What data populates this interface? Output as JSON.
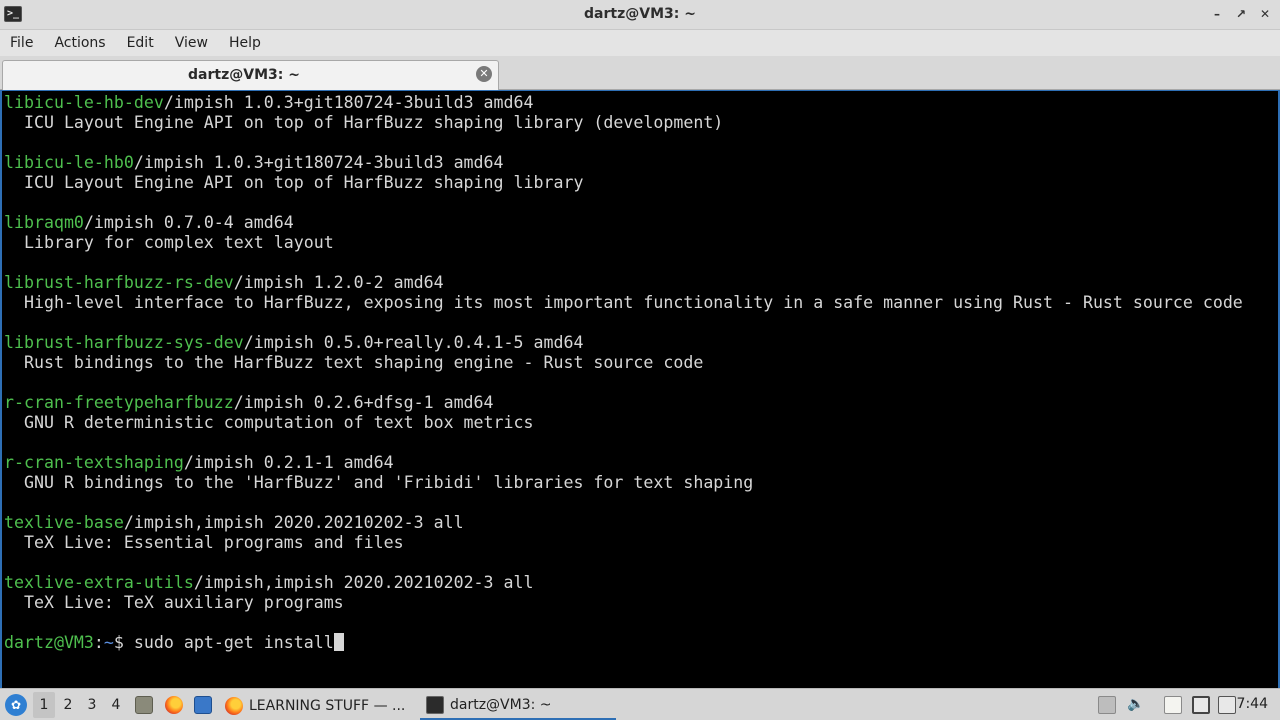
{
  "window": {
    "title": "dartz@VM3: ~",
    "app_icon": "terminal-icon",
    "controls": [
      "minimize-icon",
      "maximize-icon",
      "close-icon"
    ]
  },
  "menubar": {
    "items": [
      "File",
      "Actions",
      "Edit",
      "View",
      "Help"
    ]
  },
  "tabs": [
    {
      "label": "dartz@VM3: ~",
      "close_icon": "close-circle-icon"
    }
  ],
  "terminal": {
    "lines": [
      {
        "pkg": "libicu-le-hb-dev",
        "rest": "/impish 1.0.3+git180724-3build3 amd64"
      },
      {
        "text": "  ICU Layout Engine API on top of HarfBuzz shaping library (development)"
      },
      {
        "text": ""
      },
      {
        "pkg": "libicu-le-hb0",
        "rest": "/impish 1.0.3+git180724-3build3 amd64"
      },
      {
        "text": "  ICU Layout Engine API on top of HarfBuzz shaping library"
      },
      {
        "text": ""
      },
      {
        "pkg": "libraqm0",
        "rest": "/impish 0.7.0-4 amd64"
      },
      {
        "text": "  Library for complex text layout"
      },
      {
        "text": ""
      },
      {
        "pkg": "librust-harfbuzz-rs-dev",
        "rest": "/impish 1.2.0-2 amd64"
      },
      {
        "text": "  High-level interface to HarfBuzz, exposing its most important functionality in a safe manner using Rust - Rust source code"
      },
      {
        "text": ""
      },
      {
        "pkg": "librust-harfbuzz-sys-dev",
        "rest": "/impish 0.5.0+really.0.4.1-5 amd64"
      },
      {
        "text": "  Rust bindings to the HarfBuzz text shaping engine - Rust source code"
      },
      {
        "text": ""
      },
      {
        "pkg": "r-cran-freetypeharfbuzz",
        "rest": "/impish 0.2.6+dfsg-1 amd64"
      },
      {
        "text": "  GNU R deterministic computation of text box metrics"
      },
      {
        "text": ""
      },
      {
        "pkg": "r-cran-textshaping",
        "rest": "/impish 0.2.1-1 amd64"
      },
      {
        "text": "  GNU R bindings to the 'HarfBuzz' and 'Fribidi' libraries for text shaping"
      },
      {
        "text": ""
      },
      {
        "pkg": "texlive-base",
        "rest": "/impish,impish 2020.20210202-3 all"
      },
      {
        "text": "  TeX Live: Essential programs and files"
      },
      {
        "text": ""
      },
      {
        "pkg": "texlive-extra-utils",
        "rest": "/impish,impish 2020.20210202-3 all"
      },
      {
        "text": "  TeX Live: TeX auxiliary programs"
      },
      {
        "text": ""
      }
    ],
    "prompt": {
      "user_host": "dartz@VM3",
      "separator": ":",
      "path": "~",
      "symbol": "$ ",
      "command": "sudo apt-get install"
    }
  },
  "taskbar": {
    "start_icon": "lxqt-menu-icon",
    "workspaces": [
      "1",
      "2",
      "3",
      "4"
    ],
    "active_workspace": "1",
    "quicklaunch": [
      "file-manager-icon",
      "firefox-icon",
      "show-desktop-icon"
    ],
    "tasks": [
      {
        "label": "LEARNING STUFF — ...",
        "icon": "firefox-icon"
      },
      {
        "label": "dartz@VM3: ~",
        "icon": "terminal-icon"
      }
    ],
    "tray": [
      "clipboard-icon",
      "volume-icon",
      "notes-icon",
      "network-icon",
      "update-notifier-icon"
    ],
    "clock": "7:44"
  },
  "colors": {
    "terminal_bg": "#000000",
    "terminal_fg": "#d6d6d6",
    "package_name": "#4ebf4e",
    "prompt_path": "#5b8fe0",
    "focus_border": "#2e6fb5"
  }
}
